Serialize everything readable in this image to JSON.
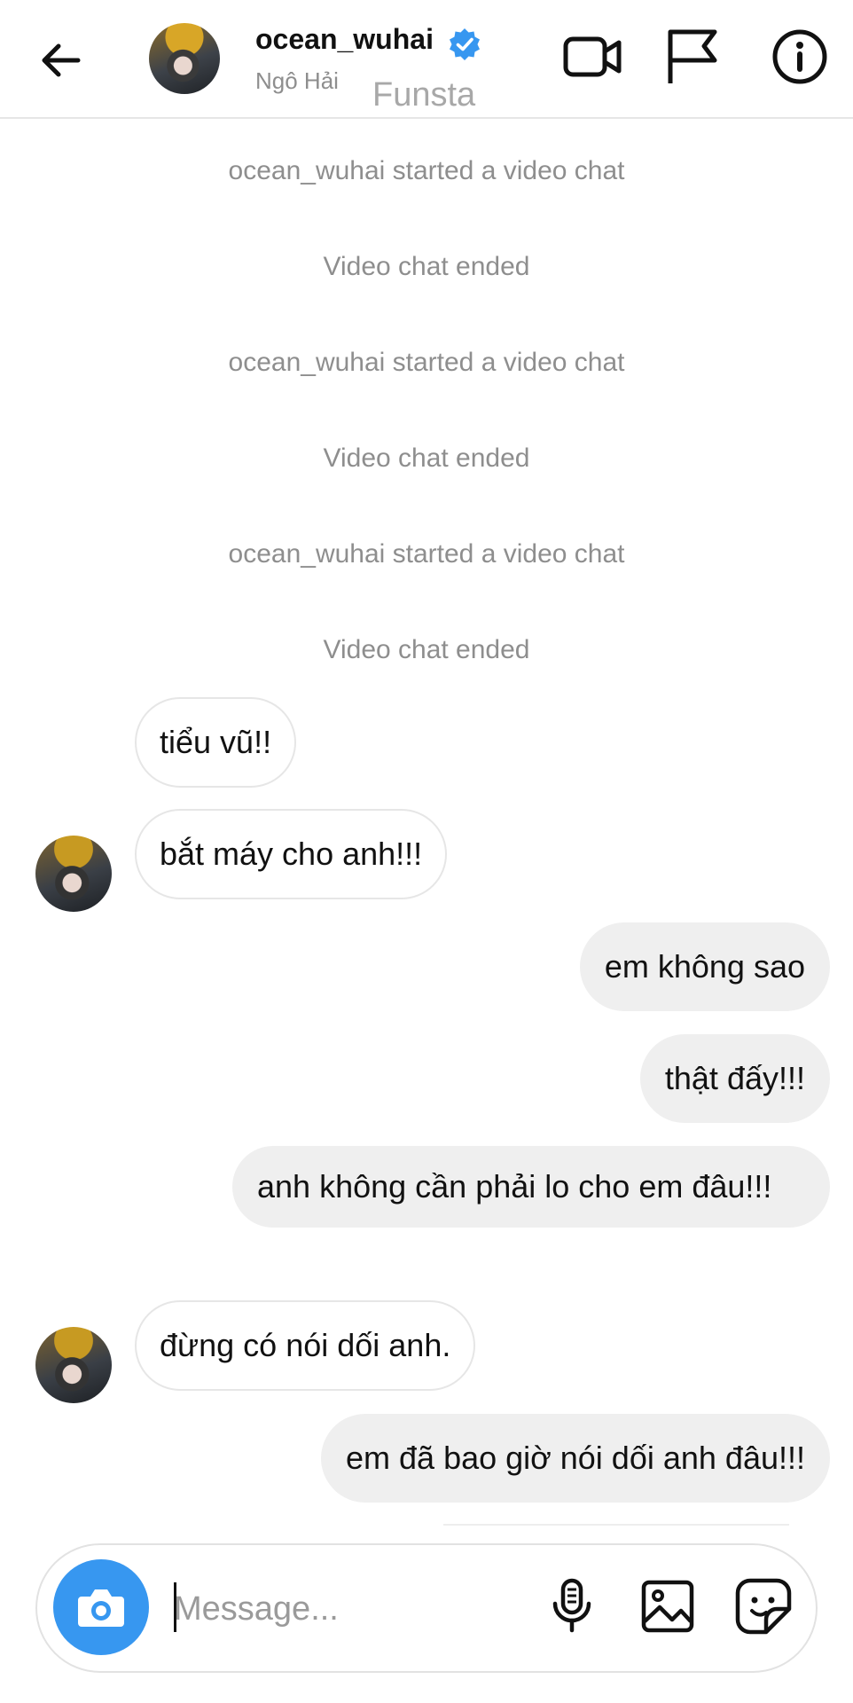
{
  "header": {
    "username": "ocean_wuhai",
    "display_name": "Ngô Hải",
    "overlay_label": "Funsta",
    "icons": [
      "back-arrow-icon",
      "verified-badge-icon",
      "video-call-icon",
      "flag-icon",
      "info-icon"
    ]
  },
  "messages": [
    {
      "type": "system",
      "text": "ocean_wuhai started a video chat"
    },
    {
      "type": "system",
      "text": "Video chat ended"
    },
    {
      "type": "system",
      "text": "ocean_wuhai started a video chat"
    },
    {
      "type": "system",
      "text": "Video chat ended"
    },
    {
      "type": "system",
      "text": "ocean_wuhai started a video chat"
    },
    {
      "type": "system",
      "text": "Video chat ended"
    },
    {
      "type": "received",
      "text": "tiểu vũ!!"
    },
    {
      "type": "received",
      "text": "bắt máy cho anh!!!"
    },
    {
      "type": "sent",
      "text": "em không sao"
    },
    {
      "type": "sent",
      "text": "thật đấy!!!"
    },
    {
      "type": "sent",
      "text": "anh không cần phải lo cho em đâu!!!"
    },
    {
      "type": "received",
      "text": "đừng có nói dối anh."
    },
    {
      "type": "sent",
      "text": "em đã bao giờ nói dối anh đâu!!!"
    }
  ],
  "composer": {
    "placeholder": "Message...",
    "value": "",
    "icons": [
      "camera-icon",
      "microphone-icon",
      "image-icon",
      "sticker-icon"
    ]
  },
  "colors": {
    "accent": "#3797f0",
    "sent_bubble": "#efefef",
    "system_text": "#8e8e8e"
  }
}
